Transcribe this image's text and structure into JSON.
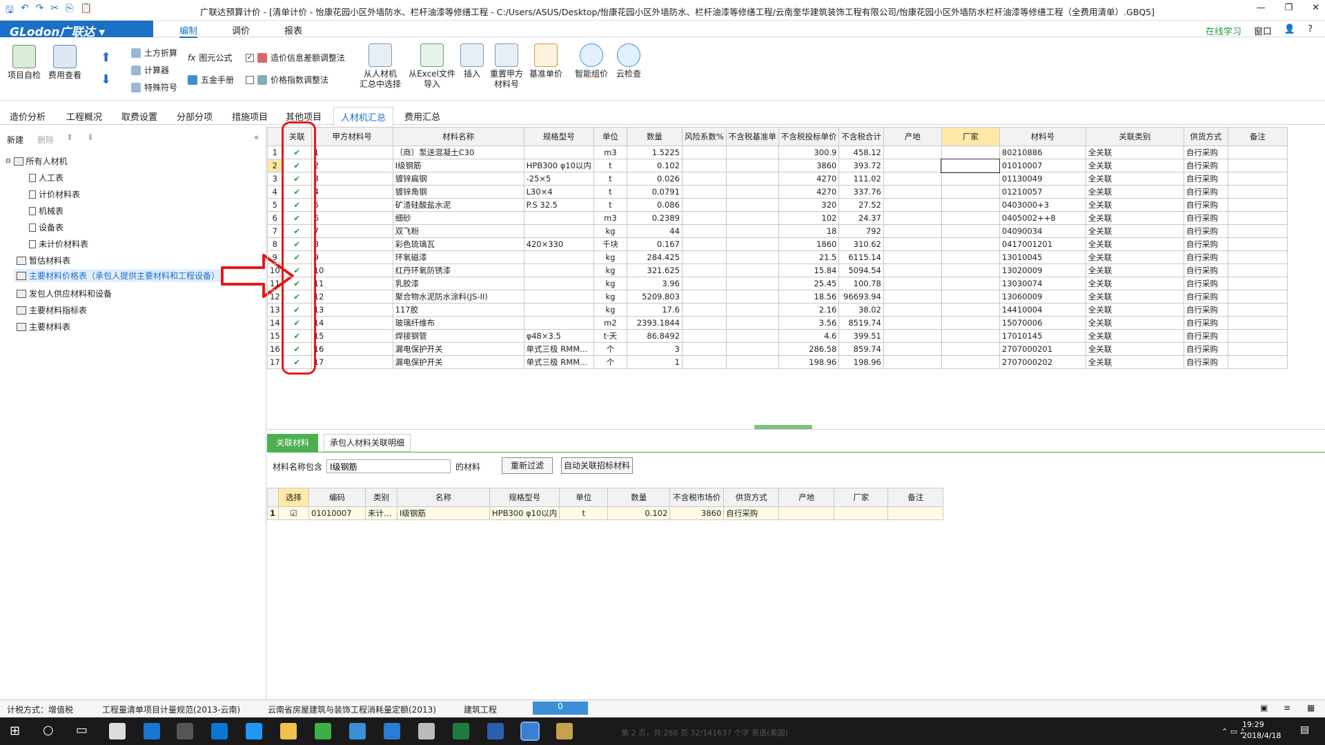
{
  "window": {
    "title": "广联达预算计价 - [清单计价 - 怡康花园小区外墙防水、栏杆油漆等修缮工程 - C:/Users/ASUS/Desktop/怡康花园小区外墙防水、栏杆油漆等修缮工程/云南奎华建筑装饰工程有限公司/怡康花园小区外墙防水栏杆油漆等修缮工程（全费用清单）.GBQ5]"
  },
  "menu": {
    "logo": "GLodon广联达 ▾",
    "tabs": [
      "编制",
      "调价",
      "报表"
    ],
    "online": "在线学习",
    "window": "窗口"
  },
  "ribbon": {
    "b1": "项目自检",
    "b2": "费用查看",
    "s1": "土方折算",
    "s2": "计算器",
    "s3": "特殊符号",
    "s4": "图元公式",
    "s5": "五金手册",
    "c1": "造价信息差额调整法",
    "c2": "价格指数调整法",
    "b3": "从人材机\n汇总中选择",
    "b4": "从Excel文件\n导入",
    "b5": "插入",
    "b6": "重置甲方\n材料号",
    "b7": "基准单价",
    "b8": "智能组价",
    "b9": "云检查"
  },
  "modtabs": [
    "造价分析",
    "工程概况",
    "取费设置",
    "分部分项",
    "措施项目",
    "其他项目",
    "人材机汇总",
    "费用汇总"
  ],
  "left": {
    "new": "新建",
    "del": "删除",
    "tree": [
      "所有人材机",
      "人工表",
      "计价材料表",
      "机械表",
      "设备表",
      "未计价材料表",
      "暂估材料表",
      "主要材料价格表（承包人提供主要材料和工程设备）",
      "发包人供应材料和设备",
      "主要材料指标表",
      "主要材料表"
    ]
  },
  "table": {
    "headers": [
      "",
      "关联",
      "甲方材料号",
      "材料名称",
      "规格型号",
      "单位",
      "数量",
      "风险系数%",
      "不含税基准单",
      "不含税投标单价",
      "不含税合计",
      "产地",
      "厂家",
      "材料号",
      "关联类别",
      "供货方式",
      "备注"
    ],
    "rows": [
      [
        "1",
        "✔",
        "1",
        "（商）泵送混凝土C30",
        "",
        "m3",
        "1.5225",
        "",
        "",
        "300.9",
        "458.12",
        "",
        "",
        "80210886",
        "全关联",
        "自行采购",
        ""
      ],
      [
        "2",
        "✔",
        "2",
        "Ⅰ级钢筋",
        "HPB300 φ10以内",
        "t",
        "0.102",
        "",
        "",
        "3860",
        "393.72",
        "",
        "",
        "01010007",
        "全关联",
        "自行采购",
        ""
      ],
      [
        "3",
        "✔",
        "3",
        "镀锌扁钢",
        "-25×5",
        "t",
        "0.026",
        "",
        "",
        "4270",
        "111.02",
        "",
        "",
        "01130049",
        "全关联",
        "自行采购",
        ""
      ],
      [
        "4",
        "✔",
        "4",
        "镀锌角钢",
        "L30×4",
        "t",
        "0.0791",
        "",
        "",
        "4270",
        "337.76",
        "",
        "",
        "01210057",
        "全关联",
        "自行采购",
        ""
      ],
      [
        "5",
        "✔",
        "5",
        "矿渣硅酸盐水泥",
        "P.S 32.5",
        "t",
        "0.086",
        "",
        "",
        "320",
        "27.52",
        "",
        "",
        "0403000+3",
        "全关联",
        "自行采购",
        ""
      ],
      [
        "6",
        "✔",
        "6",
        "细砂",
        "",
        "m3",
        "0.2389",
        "",
        "",
        "102",
        "24.37",
        "",
        "",
        "0405002++8",
        "全关联",
        "自行采购",
        ""
      ],
      [
        "7",
        "✔",
        "7",
        "双飞粉",
        "",
        "kg",
        "44",
        "",
        "",
        "18",
        "792",
        "",
        "",
        "04090034",
        "全关联",
        "自行采购",
        ""
      ],
      [
        "8",
        "✔",
        "8",
        "彩色琉璃瓦",
        "420×330",
        "千块",
        "0.167",
        "",
        "",
        "1860",
        "310.62",
        "",
        "",
        "0417001201",
        "全关联",
        "自行采购",
        ""
      ],
      [
        "9",
        "✔",
        "9",
        "环氧磁漆",
        "",
        "kg",
        "284.425",
        "",
        "",
        "21.5",
        "6115.14",
        "",
        "",
        "13010045",
        "全关联",
        "自行采购",
        ""
      ],
      [
        "10",
        "✔",
        "10",
        "红丹环氧防锈漆",
        "",
        "kg",
        "321.625",
        "",
        "",
        "15.84",
        "5094.54",
        "",
        "",
        "13020009",
        "全关联",
        "自行采购",
        ""
      ],
      [
        "11",
        "✔",
        "11",
        "乳胶漆",
        "",
        "kg",
        "3.96",
        "",
        "",
        "25.45",
        "100.78",
        "",
        "",
        "13030074",
        "全关联",
        "自行采购",
        ""
      ],
      [
        "12",
        "✔",
        "12",
        "聚合物水泥防水涂料(JS-II)",
        "",
        "kg",
        "5209.803",
        "",
        "",
        "18.56",
        "96693.94",
        "",
        "",
        "13060009",
        "全关联",
        "自行采购",
        ""
      ],
      [
        "13",
        "✔",
        "13",
        "117胶",
        "",
        "kg",
        "17.6",
        "",
        "",
        "2.16",
        "38.02",
        "",
        "",
        "14410004",
        "全关联",
        "自行采购",
        ""
      ],
      [
        "14",
        "✔",
        "14",
        "玻璃纤维布",
        "",
        "m2",
        "2393.1844",
        "",
        "",
        "3.56",
        "8519.74",
        "",
        "",
        "15070006",
        "全关联",
        "自行采购",
        ""
      ],
      [
        "15",
        "✔",
        "15",
        "焊接钢管",
        "φ48×3.5",
        "t·天",
        "86.8492",
        "",
        "",
        "4.6",
        "399.51",
        "",
        "",
        "17010145",
        "全关联",
        "自行采购",
        ""
      ],
      [
        "16",
        "✔",
        "16",
        "漏电保护开关",
        "单式三极 RMM…",
        "个",
        "3",
        "",
        "",
        "286.58",
        "859.74",
        "",
        "",
        "2707000201",
        "全关联",
        "自行采购",
        ""
      ],
      [
        "17",
        "✔",
        "17",
        "漏电保护开关",
        "单式三极 RMM…",
        "个",
        "1",
        "",
        "",
        "198.96",
        "198.96",
        "",
        "",
        "2707000202",
        "全关联",
        "自行采购",
        ""
      ]
    ]
  },
  "bottom": {
    "tabs": [
      "关联材料",
      "承包人材料关联明细"
    ],
    "filter_label": "材料名称包含",
    "filter_value": "Ⅰ级钢筋",
    "filter_suffix": "的材料",
    "btn_refilter": "重新过滤",
    "btn_auto": "自动关联招标材料",
    "headers": [
      "",
      "选择",
      "编码",
      "类别",
      "名称",
      "规格型号",
      "单位",
      "数量",
      "不含税市场价",
      "供货方式",
      "产地",
      "厂家",
      "备注"
    ],
    "row": [
      "1",
      "☑",
      "01010007",
      "未计…",
      "Ⅰ级钢筋",
      "HPB300 φ10以内",
      "t",
      "0.102",
      "3860",
      "自行采购",
      "",
      "",
      ""
    ]
  },
  "status": {
    "tax": "计税方式：增值税",
    "spec": "工程量清单项目计量规范(2013-云南)",
    "quota": "云南省房屋建筑与装饰工程消耗量定额(2013)",
    "type": "建筑工程",
    "count": "0"
  },
  "taskbar": {
    "time": "19:29",
    "date": "2018/4/18",
    "ghost": "第 2 页，共 288 页    32/141637 个字    英语(美国)"
  },
  "colors": {
    "brand": "#1b6fc6",
    "check": "#1f9b3c",
    "annotation": "#e51919",
    "highlight": "#ffe9a8"
  }
}
